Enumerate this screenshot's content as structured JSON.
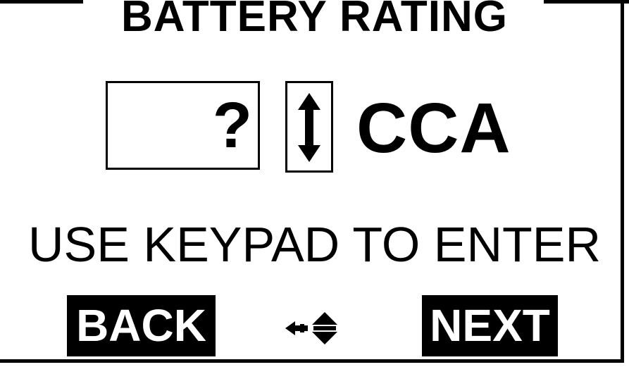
{
  "screen": {
    "title": "BATTERY RATING",
    "entry_value": "?",
    "unit": "CCA",
    "instruction": "USE KEYPAD TO ENTER"
  },
  "softkeys": {
    "back_label": "BACK",
    "next_label": "NEXT"
  },
  "icons": {
    "stepper": "up-down-arrow-icon",
    "navigation": "left-right-and-up-down-arrows-icon"
  },
  "colors": {
    "foreground": "#000000",
    "background": "#ffffff",
    "softkey_text": "#ffffff"
  }
}
